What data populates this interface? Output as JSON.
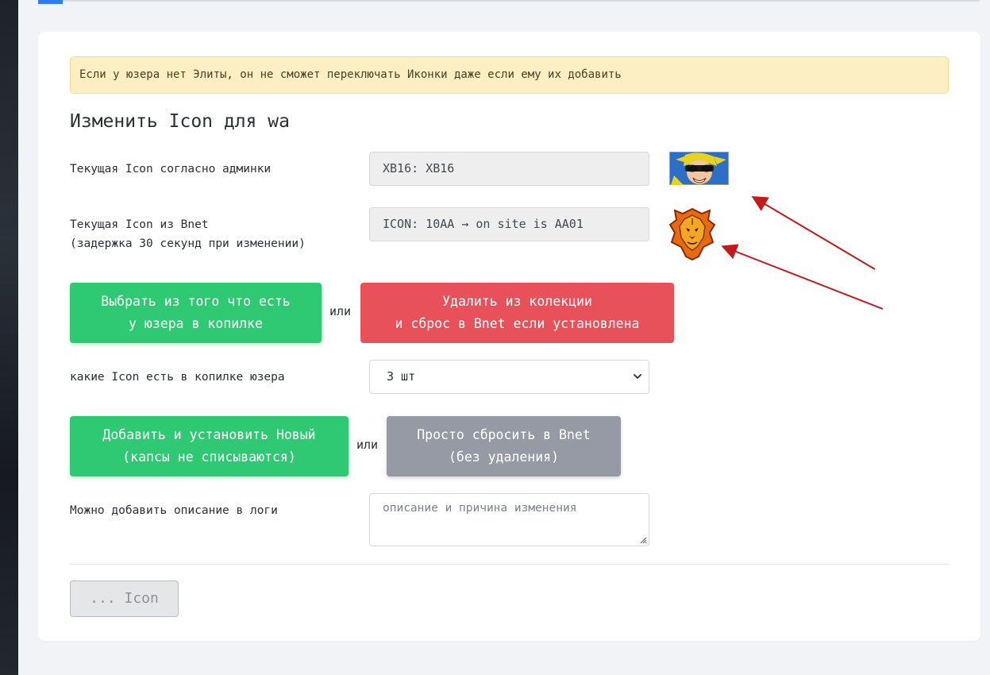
{
  "alert": {
    "text": "Если у юзера нет Элиты, он не сможет переключать Иконки даже если ему их добавить"
  },
  "heading": "Изменить Icon для wa",
  "current_admin": {
    "label": "Текущая Icon согласно админки",
    "value": "XB16: XB16",
    "icon": "character-avatar-icon"
  },
  "current_bnet": {
    "label_line1": "Текущая Icon из Bnet",
    "label_line2": "(задержка 30 секунд при изменении)",
    "value": "ICON: 10AA → on site is AA01",
    "icon": "lion-emblem-icon"
  },
  "actions_top": {
    "choose_line1": "Выбрать из того что есть",
    "choose_line2": "у юзера в копилке",
    "or_label": "или",
    "delete_line1": "Удалить из колекции",
    "delete_line2": "и сброс в Bnet если установлена"
  },
  "collection": {
    "label": "какие Icon есть в копилке юзера",
    "selected": "3 шт"
  },
  "actions_bottom": {
    "add_line1": "Добавить и установить Новый",
    "add_line2": "(капсы не списываются)",
    "or_label": "или",
    "reset_line1": "Просто сбросить в Bnet",
    "reset_line2": "(без удаления)"
  },
  "log": {
    "label": "Можно добавить описание в логи",
    "placeholder": "описание и причина изменения"
  },
  "submit": {
    "label": "... Icon"
  },
  "colors": {
    "green": "#2ec972",
    "red": "#e8505a",
    "gray": "#959aa5",
    "alert_bg": "#fcefc3",
    "accent_blue": "#2f7cf6",
    "arrow_red": "#c41a1a"
  }
}
